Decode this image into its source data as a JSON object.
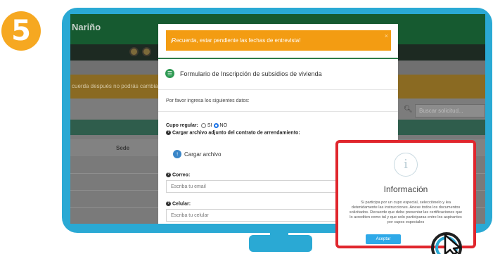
{
  "step_number": "5",
  "background_app": {
    "brand": "Nariño",
    "warning_text": "cuerda después no podrás cambia",
    "search_placeholder": "Buscar solicitud...",
    "table_column_sede": "Sede"
  },
  "modal": {
    "alert_text": "¡Recuerda, estar pendiente las fechas de entrevista!",
    "alert_close": "×",
    "title": "Formulario de Inscripción de subsidios de vivienda",
    "instructions": "Por favor ingresa los siguientes datos:",
    "cupo_label": "Cupo regular:",
    "cupo_options": [
      "SI",
      "NO"
    ],
    "cupo_selected": "NO",
    "contract_label": "Cargar archivo adjunto del contrato de arrendamiento:",
    "upload_button": "Cargar archivo",
    "email_label": "Correo:",
    "email_placeholder": "Escriba tu email",
    "phone_label": "Celular:",
    "phone_placeholder": "Escriba tu celular"
  },
  "info_popup": {
    "icon": "i",
    "title": "Información",
    "body": "Si participa por un cupo especial, selecciónelo y lea detenidamente las instrucciones. Anexe todos los documentos solicitados. Recuerde que debe presentar las certificaciones que lo acrediten como tal y que solo participaras entre los aspirantes por cupos especiales",
    "accept_button": "Aceptar"
  },
  "colors": {
    "monitor": "#2aa9d4",
    "step_badge": "#f6a821",
    "alert": "#f39c12",
    "highlight_border": "#e0262d",
    "accept_button": "#2ea9e8"
  }
}
